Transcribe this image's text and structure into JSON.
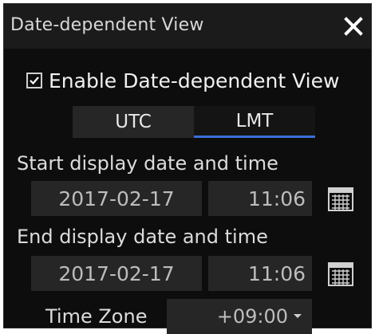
{
  "dialog": {
    "title": "Date-dependent View",
    "close_icon": "close-icon"
  },
  "enable": {
    "label": "Enable Date-dependent View",
    "checked": true
  },
  "tabs": [
    {
      "label": "UTC",
      "selected": false
    },
    {
      "label": "LMT",
      "selected": true
    }
  ],
  "start": {
    "label": "Start display date and time",
    "date": "2017-02-17",
    "time": "11:06",
    "calendar_icon": "calendar-icon"
  },
  "end": {
    "label": "End display date and time",
    "date": "2017-02-17",
    "time": "11:06",
    "calendar_icon": "calendar-icon"
  },
  "timezone": {
    "label": "Time Zone",
    "value": "+09:00",
    "icon": "chevron-down-icon"
  },
  "colors": {
    "background": "#0d0d0d",
    "titlebar": "#1b1b1b",
    "field": "#262626",
    "accent": "#3b6fd8",
    "text": "#f0f0f0"
  }
}
